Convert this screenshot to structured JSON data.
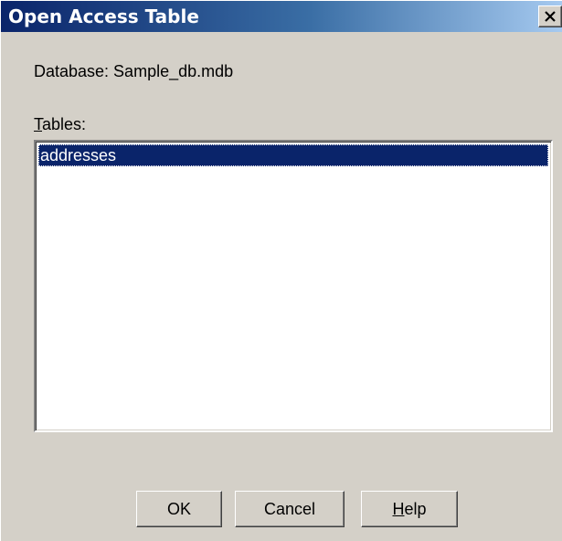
{
  "window": {
    "title": "Open Access Table",
    "close_symbol": "close-icon"
  },
  "database": {
    "label": "Database: Sample_db.mdb"
  },
  "tables": {
    "label_mnemonic": "T",
    "label_rest": "ables:",
    "items": [
      {
        "label": "addresses",
        "selected": true
      }
    ]
  },
  "buttons": {
    "ok_label": "OK",
    "cancel_label": "Cancel",
    "help_mnemonic": "H",
    "help_rest": "elp"
  },
  "colors": {
    "titlebar_start": "#0a246a",
    "titlebar_end": "#a6caf0",
    "face": "#d4d0c8",
    "selection": "#0a246a"
  }
}
